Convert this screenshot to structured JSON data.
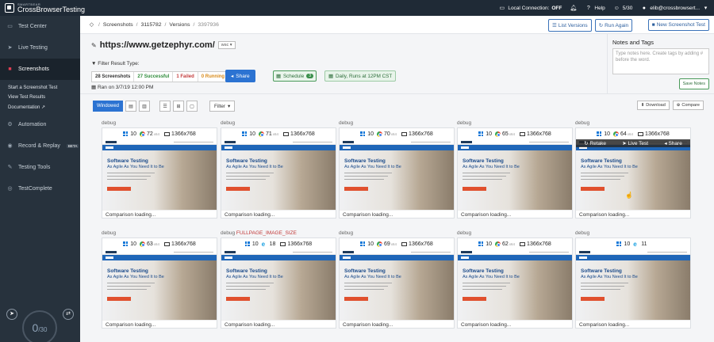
{
  "topbar": {
    "logo_small": "SMARTBEAR",
    "logo_name": "CrossBrowserTesting",
    "local_connection_label": "Local Connection:",
    "local_connection_value": "OFF",
    "help": "Help",
    "sessions": "5/30",
    "user": "elib@crossbrowsert..."
  },
  "sidebar": {
    "items": [
      {
        "label": "Test Center",
        "icon": "monitor-icon"
      },
      {
        "label": "Live Testing",
        "icon": "cursor-icon"
      },
      {
        "label": "Screenshots",
        "icon": "camera-icon"
      },
      {
        "label": "Automation",
        "icon": "gear-icon"
      },
      {
        "label": "Record & Replay",
        "icon": "record-icon",
        "badge": "BETA"
      },
      {
        "label": "Testing Tools",
        "icon": "wrench-icon"
      },
      {
        "label": "TestComplete",
        "icon": "globe-icon"
      }
    ],
    "sub_items": [
      "Start a Screenshot Test",
      "View Test Results",
      "Documentation"
    ],
    "gauge_value": "0",
    "gauge_total": "/30"
  },
  "breadcrumb": {
    "items": [
      "Screenshots",
      "3115782",
      "Versions"
    ],
    "last": "3397936"
  },
  "buttons": {
    "list_versions": "List Versions",
    "run_again": "Run Again",
    "new_screenshot_test": "New Screenshot Test",
    "share": "Share",
    "schedule": "Schedule",
    "schedule_count": "3",
    "daily": "Daily, Runs at 12PM CST",
    "windowed": "Windowed",
    "filter": "Filter",
    "download": "Download",
    "compare": "Compare",
    "save_notes": "Save Notes"
  },
  "url": {
    "text": "https://www.getzephyr.com/",
    "selector": "wsc"
  },
  "filters": {
    "label": "Filter Result Type:",
    "tags": [
      {
        "label": "28 Screenshots",
        "color": "#333333"
      },
      {
        "label": "27 Successful",
        "color": "#2e8b3a"
      },
      {
        "label": "1 Failed",
        "color": "#c23a3a"
      },
      {
        "label": "0 Running",
        "color": "#d88a1a"
      }
    ],
    "ran_on": "Ran on 3/7/19 12:00 PM"
  },
  "notes": {
    "title": "Notes and Tags",
    "placeholder": "Type notes here. Create tags by adding # before the word."
  },
  "shot_content": {
    "title": "Software Testing",
    "subtitle": "As Agile As You Need It to Be"
  },
  "cards": [
    {
      "label": "debug",
      "extra": "",
      "os": "10",
      "browser": "chrome",
      "ver": "72",
      "arch": "x64",
      "res": "1366x768",
      "footer": "Comparison loading...",
      "hover": false
    },
    {
      "label": "debug",
      "extra": "",
      "os": "10",
      "browser": "chrome",
      "ver": "71",
      "arch": "x64",
      "res": "1366x768",
      "footer": "Comparison loading...",
      "hover": false
    },
    {
      "label": "debug",
      "extra": "",
      "os": "10",
      "browser": "chrome",
      "ver": "70",
      "arch": "x64",
      "res": "1366x768",
      "footer": "Comparison loading...",
      "hover": false
    },
    {
      "label": "debug",
      "extra": "",
      "os": "10",
      "browser": "chrome",
      "ver": "65",
      "arch": "x64",
      "res": "1366x768",
      "footer": "Comparison loading...",
      "hover": false
    },
    {
      "label": "debug",
      "extra": "",
      "os": "10",
      "browser": "chrome",
      "ver": "64",
      "arch": "x64",
      "res": "1366x768",
      "footer": "Comparison loading...",
      "hover": true
    },
    {
      "label": "debug",
      "extra": "",
      "os": "10",
      "browser": "chrome",
      "ver": "63",
      "arch": "x64",
      "res": "1366x768",
      "footer": "Comparison loading...",
      "hover": false
    },
    {
      "label": "debug",
      "extra": "FULLPAGE_IMAGE_SIZE",
      "os": "10",
      "browser": "ie",
      "ver": "18",
      "arch": "",
      "res": "1366x768",
      "footer": "Comparison loading...",
      "hover": false
    },
    {
      "label": "debug",
      "extra": "",
      "os": "10",
      "browser": "chrome",
      "ver": "69",
      "arch": "x64",
      "res": "1366x768",
      "footer": "Comparison loading...",
      "hover": false
    },
    {
      "label": "debug",
      "extra": "",
      "os": "10",
      "browser": "chrome",
      "ver": "62",
      "arch": "x64",
      "res": "1366x768",
      "footer": "Comparison loading...",
      "hover": false
    },
    {
      "label": "debug",
      "extra": "",
      "os": "10",
      "browser": "ie",
      "ver": "11",
      "arch": "",
      "res": "",
      "footer": "Comparison loading...",
      "hover": false
    }
  ],
  "hover_actions": [
    "Retake",
    "Live Test",
    "Share"
  ]
}
